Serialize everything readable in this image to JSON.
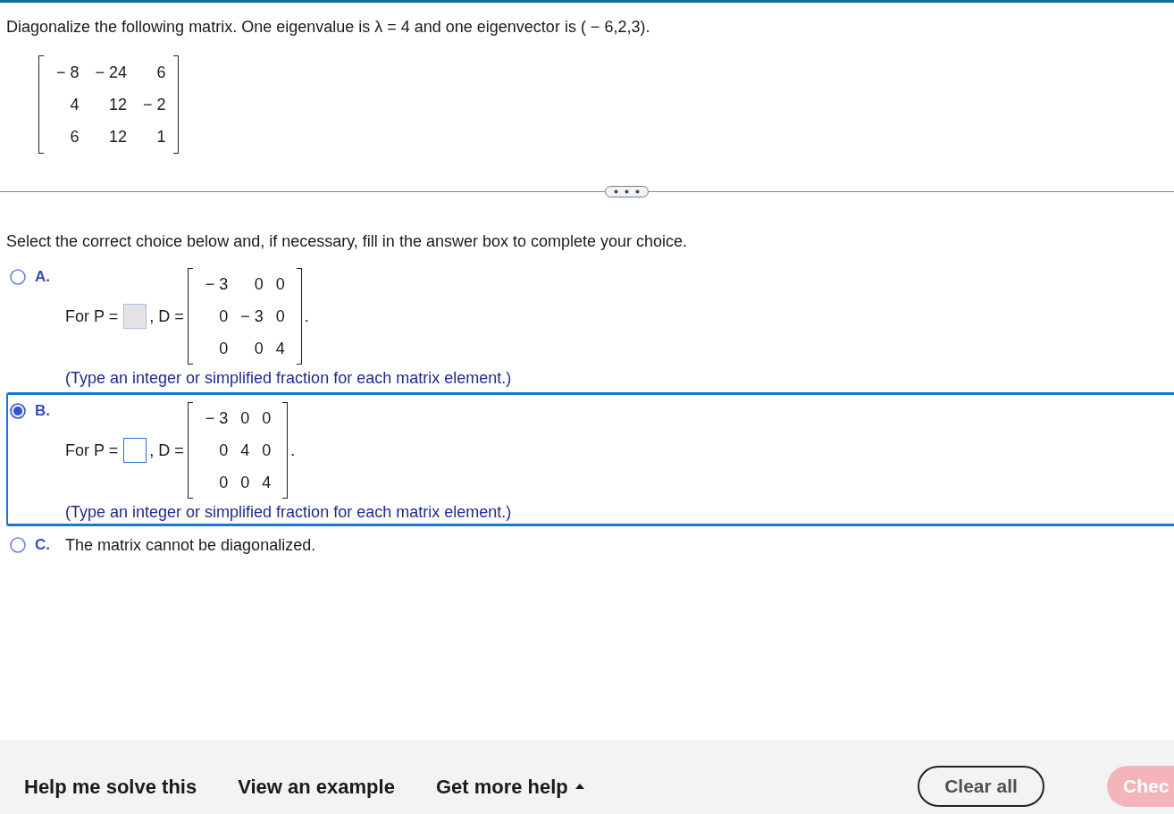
{
  "question": {
    "text": "Diagonalize the following matrix. One eigenvalue is λ = 4 and one eigenvector is ( − 6,2,3).",
    "matrix": [
      [
        "− 8",
        "− 24",
        "6"
      ],
      [
        "4",
        "12",
        "− 2"
      ],
      [
        "6",
        "12",
        "1"
      ]
    ]
  },
  "instruction": "Select the correct choice below and, if necessary, fill in the answer box to complete your choice.",
  "choices": [
    {
      "letter": "A.",
      "selected": false,
      "kind": "matrix",
      "prefix": "For P =",
      "mid": ", D =",
      "matrix": [
        [
          "− 3",
          "0",
          "0"
        ],
        [
          "0",
          "− 3",
          "0"
        ],
        [
          "0",
          "0",
          "4"
        ]
      ],
      "suffix": ".",
      "hint": "(Type an integer or simplified fraction for each matrix element.)"
    },
    {
      "letter": "B.",
      "selected": true,
      "kind": "matrix",
      "prefix": "For P =",
      "mid": ", D =",
      "matrix": [
        [
          "− 3",
          "0",
          "0"
        ],
        [
          "0",
          "4",
          "0"
        ],
        [
          "0",
          "0",
          "4"
        ]
      ],
      "suffix": ".",
      "hint": "(Type an integer or simplified fraction for each matrix element.)"
    },
    {
      "letter": "C.",
      "selected": false,
      "kind": "text",
      "text": "The matrix cannot be diagonalized."
    }
  ],
  "footer": {
    "links": [
      {
        "label": "Help me solve this",
        "kind": "link"
      },
      {
        "label": "View an example",
        "kind": "link"
      },
      {
        "label": "Get more help",
        "kind": "menu"
      }
    ],
    "buttons": [
      {
        "label": "Clear all",
        "kind": "outline",
        "disabled": false
      },
      {
        "label": "Chec",
        "kind": "primary",
        "disabled": true
      }
    ]
  }
}
